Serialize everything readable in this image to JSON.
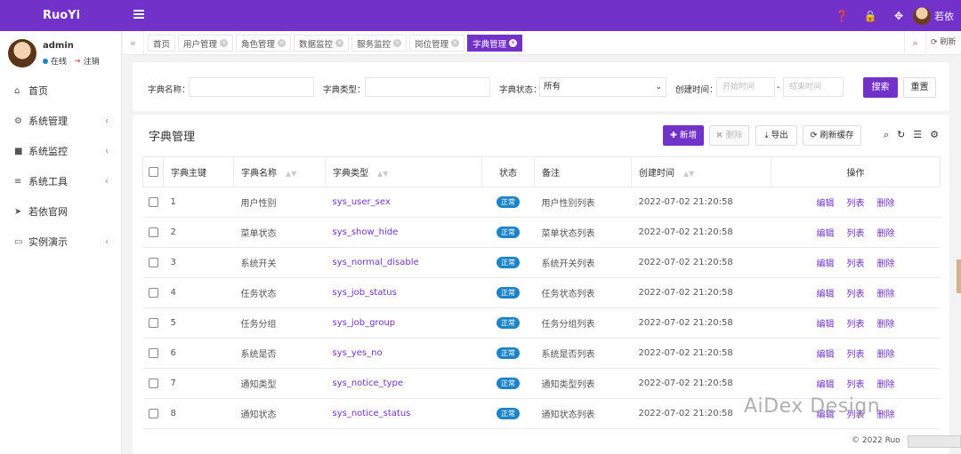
{
  "app": {
    "logo": "RuoYi",
    "user_name": "若依"
  },
  "sidebar": {
    "profile": {
      "name": "admin",
      "status": "在线",
      "logout": "注销"
    },
    "items": [
      {
        "label": "首页",
        "icon": "home-icon",
        "has_arrow": false
      },
      {
        "label": "系统管理",
        "icon": "gear-icon",
        "has_arrow": true
      },
      {
        "label": "系统监控",
        "icon": "video-icon",
        "has_arrow": true
      },
      {
        "label": "系统工具",
        "icon": "bars-icon",
        "has_arrow": true
      },
      {
        "label": "若依官网",
        "icon": "send-icon",
        "has_arrow": false
      },
      {
        "label": "实例演示",
        "icon": "desktop-icon",
        "has_arrow": true
      }
    ]
  },
  "tabs": {
    "items": [
      "首页",
      "用户管理",
      "角色管理",
      "数据监控",
      "服务监控",
      "岗位管理",
      "字典管理"
    ],
    "active": "字典管理",
    "refresh": "刷新"
  },
  "search": {
    "name_label": "字典名称：",
    "type_label": "字典类型：",
    "status_label": "字典状态：",
    "status_value": "所有",
    "time_label": "创建时间：",
    "start_placeholder": "开始时间",
    "end_placeholder": "结束时间",
    "search_btn": "搜索",
    "reset_btn": "重置"
  },
  "main": {
    "title": "字典管理",
    "add_btn": "新增",
    "delete_btn": "删除",
    "export_btn": "导出",
    "refresh_cache_btn": "刷新缓存"
  },
  "table": {
    "headers": [
      "字典主键",
      "字典名称",
      "字典类型",
      "状态",
      "备注",
      "创建时间",
      "操作"
    ],
    "rows": [
      {
        "id": "1",
        "name": "用户性别",
        "type": "sys_user_sex",
        "status": "正常",
        "remark": "用户性别列表",
        "time": "2022-07-02 21:20:58"
      },
      {
        "id": "2",
        "name": "菜单状态",
        "type": "sys_show_hide",
        "status": "正常",
        "remark": "菜单状态列表",
        "time": "2022-07-02 21:20:58"
      },
      {
        "id": "3",
        "name": "系统开关",
        "type": "sys_normal_disable",
        "status": "正常",
        "remark": "系统开关列表",
        "time": "2022-07-02 21:20:58"
      },
      {
        "id": "4",
        "name": "任务状态",
        "type": "sys_job_status",
        "status": "正常",
        "remark": "任务状态列表",
        "time": "2022-07-02 21:20:58"
      },
      {
        "id": "5",
        "name": "任务分组",
        "type": "sys_job_group",
        "status": "正常",
        "remark": "任务分组列表",
        "time": "2022-07-02 21:20:58"
      },
      {
        "id": "6",
        "name": "系统是否",
        "type": "sys_yes_no",
        "status": "正常",
        "remark": "系统是否列表",
        "time": "2022-07-02 21:20:58"
      },
      {
        "id": "7",
        "name": "通知类型",
        "type": "sys_notice_type",
        "status": "正常",
        "remark": "通知类型列表",
        "time": "2022-07-02 21:20:58"
      },
      {
        "id": "8",
        "name": "通知状态",
        "type": "sys_notice_status",
        "status": "正常",
        "remark": "通知状态列表",
        "time": "2022-07-02 21:20:58"
      }
    ],
    "ops": [
      "编辑",
      "列表",
      "删除"
    ]
  },
  "footer": {
    "text": "© 2022 Ruo"
  },
  "watermark": "AiDex Design",
  "colors": {
    "accent": "#7232c9",
    "badge": "#1c84c6"
  }
}
